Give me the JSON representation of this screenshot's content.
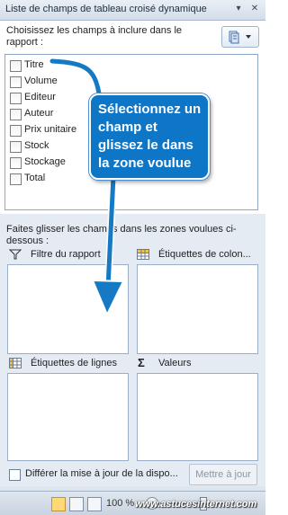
{
  "pane": {
    "title": "Liste de champs de tableau croisé dynamique",
    "menu_icon": "dropdown-arrow-icon",
    "close_icon": "close-icon"
  },
  "fields_section": {
    "instruction": "Choisissez les champs à inclure dans le rapport :",
    "layout_button_icon": "layout-options-icon",
    "fields": [
      {
        "label": "Titre",
        "checked": false
      },
      {
        "label": "Volume",
        "checked": false
      },
      {
        "label": "Editeur",
        "checked": false
      },
      {
        "label": "Auteur",
        "checked": false
      },
      {
        "label": "Prix unitaire",
        "checked": false
      },
      {
        "label": "Stock",
        "checked": false
      },
      {
        "label": "Stockage",
        "checked": false
      },
      {
        "label": "Total",
        "checked": false
      }
    ]
  },
  "areas_section": {
    "instruction": "Faites glisser les champs dans les zones voulues ci-dessous :",
    "report_filter": {
      "label": "Filtre du rapport",
      "icon": "filter-icon"
    },
    "column_labels": {
      "label": "Étiquettes de colon...",
      "icon": "column-grid-icon"
    },
    "row_labels": {
      "label": "Étiquettes de lignes",
      "icon": "row-grid-icon"
    },
    "values": {
      "label": "Valeurs",
      "icon": "sigma-icon"
    }
  },
  "footer": {
    "defer_label": "Différer la mise à jour de la dispo...",
    "defer_checked": false,
    "update_button": "Mettre à jour"
  },
  "statusbar": {
    "zoom": "100 %",
    "zoom_minus": "−"
  },
  "callout": {
    "text": "Sélectionnez un champ et glissez le dans la zone voulue"
  },
  "watermark": "www.astucesinternet.com",
  "colors": {
    "callout_blue": "#0d76c6",
    "arrow_blue": "#1579c4",
    "pane_background": "#dde5ee"
  }
}
